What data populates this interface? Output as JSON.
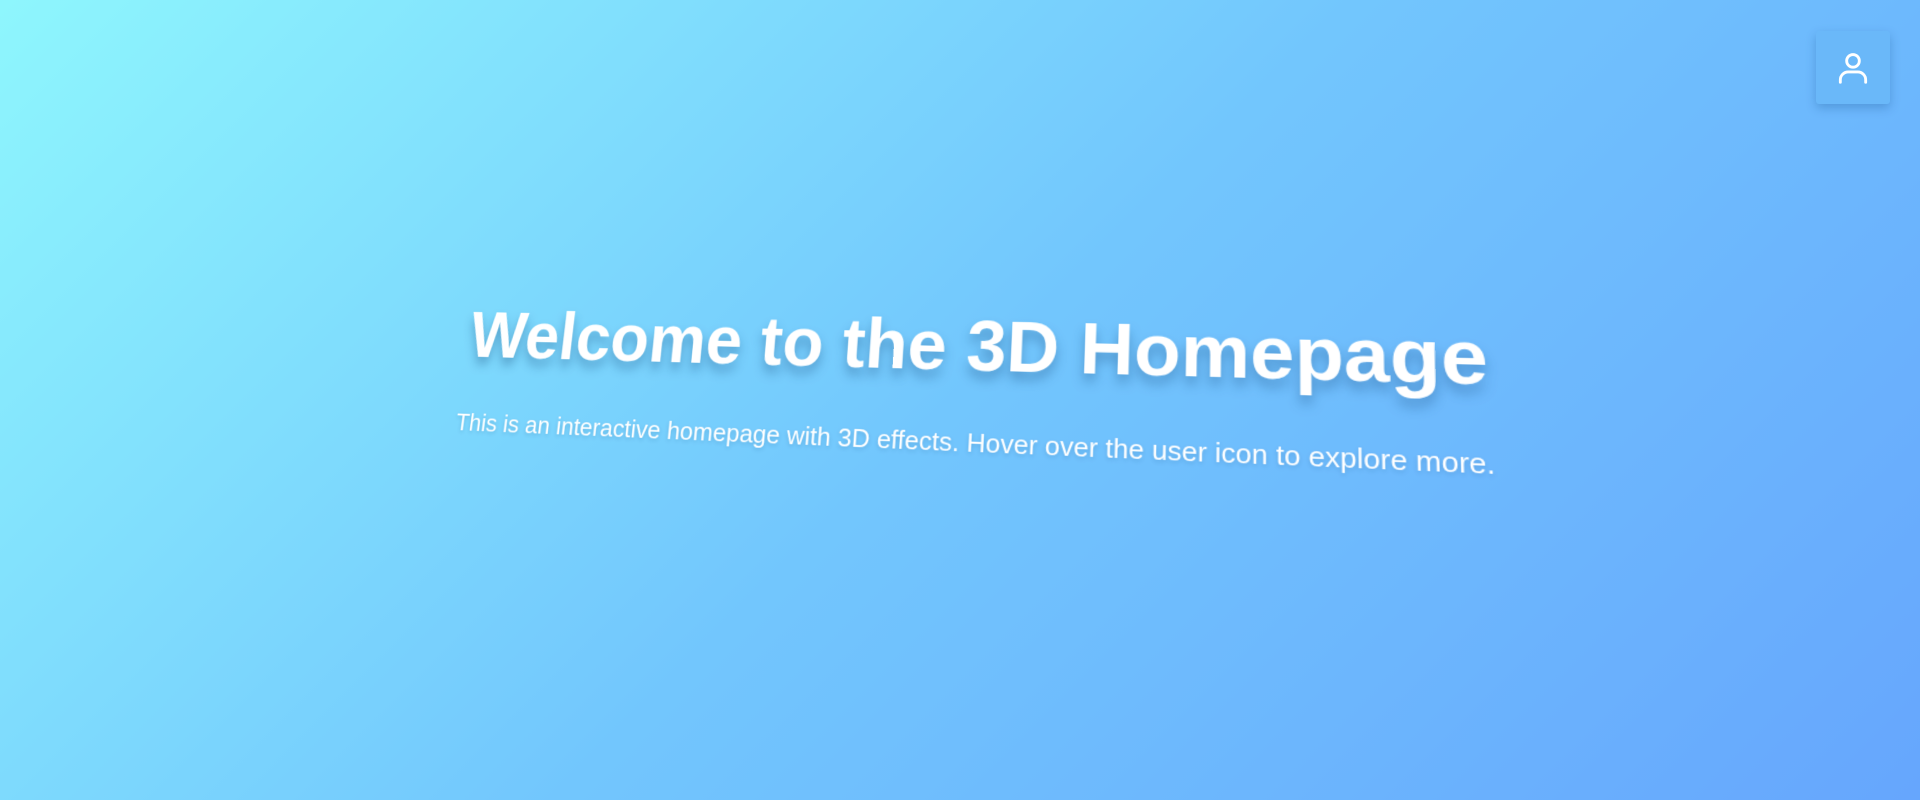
{
  "header": {
    "user_button": {
      "icon": "user-icon",
      "icon_color": "#ffffff",
      "background": "#6ab8f9"
    }
  },
  "hero": {
    "title": "Welcome to the 3D Homepage",
    "subtitle": "This is an interactive homepage with 3D effects. Hover over the user icon to explore more."
  },
  "theme": {
    "gradient_start": "#8ef6fd",
    "gradient_end": "#66a6fd",
    "text_color": "#ffffff"
  }
}
